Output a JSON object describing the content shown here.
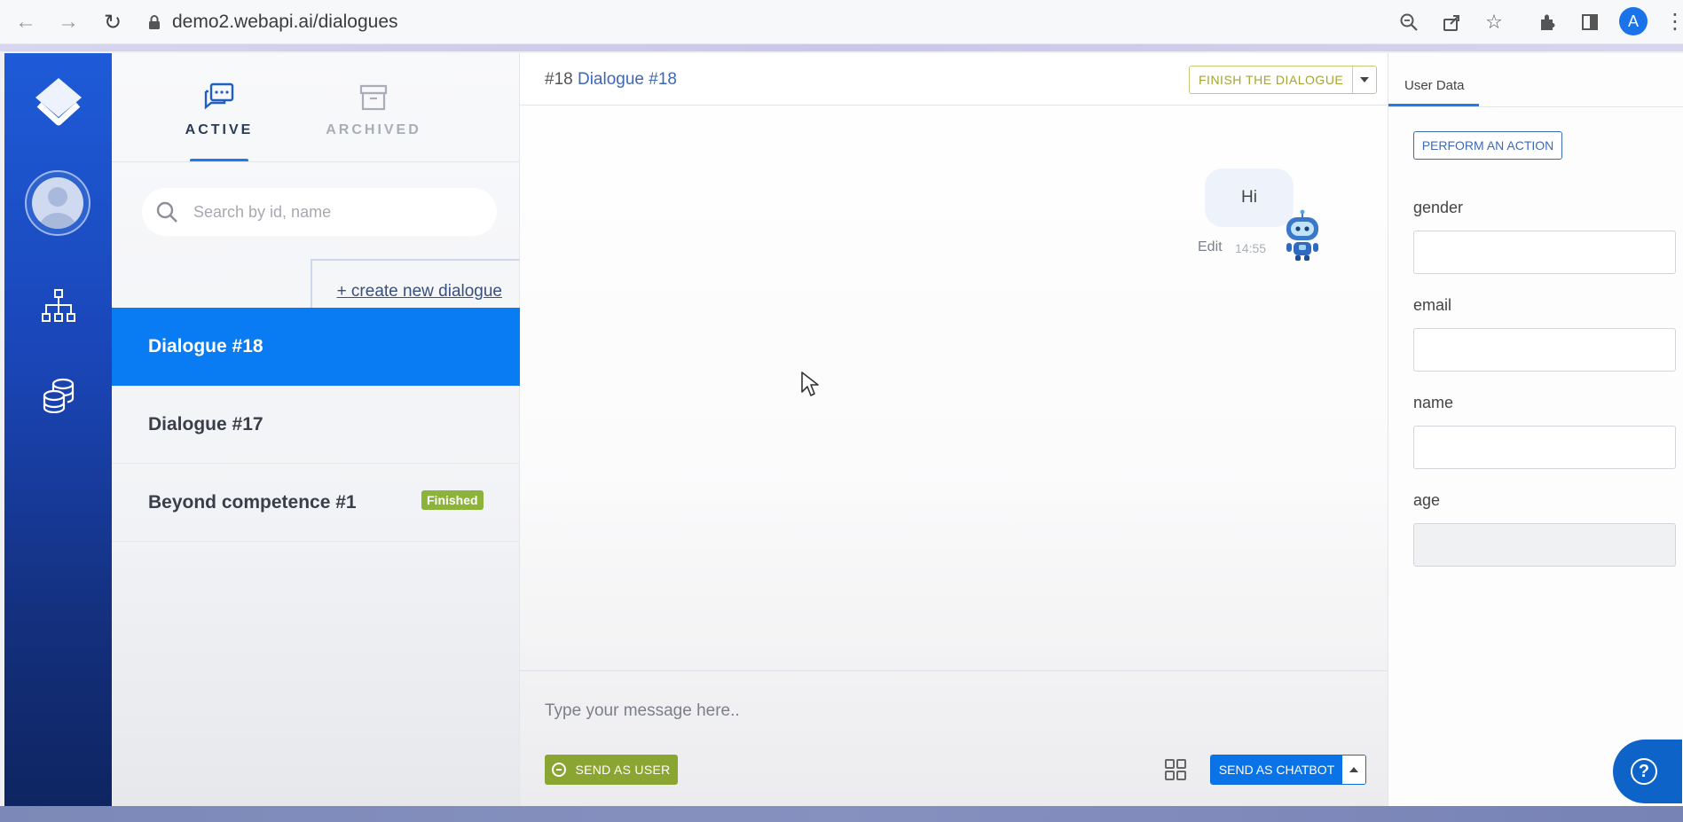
{
  "browser": {
    "url": "demo2.webapi.ai/dialogues",
    "profile_initial": "A",
    "icons": [
      "back-icon",
      "forward-icon",
      "reload-icon",
      "lock-icon",
      "zoom-icon",
      "share-icon",
      "star-icon",
      "extensions-icon",
      "side-panel-icon",
      "menu-icon"
    ]
  },
  "rail": {
    "icons": [
      "logo-icon",
      "avatar",
      "org-chart-icon",
      "database-icon"
    ]
  },
  "dialogue_list": {
    "tabs": [
      {
        "label": "ACTIVE",
        "icon": "chat-icon",
        "active": true
      },
      {
        "label": "ARCHIVED",
        "icon": "archive-icon",
        "active": false
      }
    ],
    "search_placeholder": "Search by id, name",
    "create_link": "+ create new dialogue",
    "items": [
      {
        "title": "Dialogue #18",
        "selected": true,
        "badge": ""
      },
      {
        "title": "Dialogue #17",
        "selected": false,
        "badge": ""
      },
      {
        "title": "Beyond competence #1",
        "selected": false,
        "badge": "Finished"
      }
    ]
  },
  "chat": {
    "header_id": "#18",
    "header_title": "Dialogue #18",
    "finish_button": "FINISH THE DIALOGUE",
    "messages": [
      {
        "text": "Hi",
        "edit_label": "Edit",
        "time": "14:55",
        "avatar": "robot-icon"
      }
    ],
    "composer_placeholder": "Type your message here..",
    "send_user_label": "SEND AS USER",
    "send_bot_label": "SEND AS CHATBOT"
  },
  "user_data": {
    "tab_label": "User Data",
    "action_button": "PERFORM AN ACTION",
    "fields": [
      {
        "label": "gender",
        "value": ""
      },
      {
        "label": "email",
        "value": ""
      },
      {
        "label": "name",
        "value": ""
      },
      {
        "label": "age",
        "value": ""
      }
    ]
  },
  "colors": {
    "accent": "#0a7cf3",
    "rail_top": "#1e5bd8",
    "rail_bottom": "#0e2561",
    "send_user": "#8ba532",
    "finished_badge": "#8cb33a"
  }
}
